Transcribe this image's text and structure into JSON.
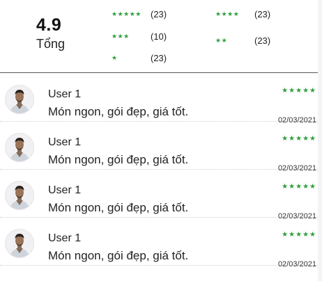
{
  "summary": {
    "score": "4.9",
    "score_label": "Tổng",
    "breakdown": [
      {
        "stars": "★★★★★",
        "count": "(23)"
      },
      {
        "stars": "★★★★",
        "count": "(23)"
      },
      {
        "stars": "★★★",
        "count": "(10)"
      },
      {
        "stars": "★★",
        "count": "(23)"
      },
      {
        "stars": "★",
        "count": "(23)"
      }
    ]
  },
  "reviews": [
    {
      "user": "User 1",
      "comment": "Món ngon, gói đẹp, giá tốt.",
      "stars": "★★★★★",
      "date": "02/03/2021"
    },
    {
      "user": "User 1",
      "comment": "Món ngon, gói đẹp, giá tốt.",
      "stars": "★★★★★",
      "date": "02/03/2021"
    },
    {
      "user": "User 1",
      "comment": "Món ngon, gói đẹp, giá tốt.",
      "stars": "★★★★★",
      "date": "02/03/2021"
    },
    {
      "user": "User 1",
      "comment": "Món ngon, gói đẹp, giá tốt.",
      "stars": "★★★★★",
      "date": "02/03/2021"
    }
  ],
  "colors": {
    "star": "#2e9e3a",
    "divider": "#555555"
  },
  "icons": {
    "avatar": "user-avatar-photo"
  }
}
